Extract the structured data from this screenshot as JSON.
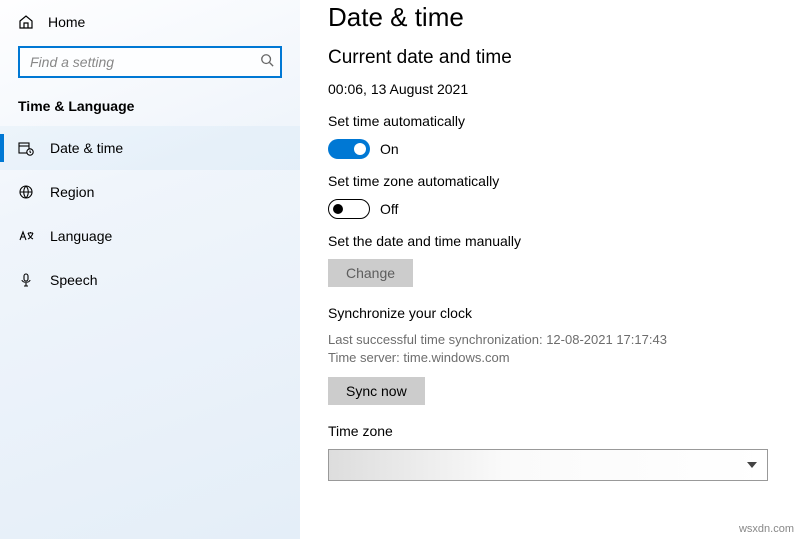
{
  "sidebar": {
    "home": "Home",
    "search_placeholder": "Find a setting",
    "category": "Time & Language",
    "items": [
      {
        "label": "Date & time"
      },
      {
        "label": "Region"
      },
      {
        "label": "Language"
      },
      {
        "label": "Speech"
      }
    ]
  },
  "main": {
    "title": "Date & time",
    "section_current": "Current date and time",
    "current_value": "00:06, 13 August 2021",
    "set_time_auto_label": "Set time automatically",
    "set_time_auto_state": "On",
    "set_tz_auto_label": "Set time zone automatically",
    "set_tz_auto_state": "Off",
    "manual_label": "Set the date and time manually",
    "change_btn": "Change",
    "sync_heading": "Synchronize your clock",
    "sync_last": "Last successful time synchronization: 12-08-2021 17:17:43",
    "sync_server": "Time server: time.windows.com",
    "sync_btn": "Sync now",
    "tz_heading": "Time zone"
  },
  "watermark": "wsxdn.com"
}
